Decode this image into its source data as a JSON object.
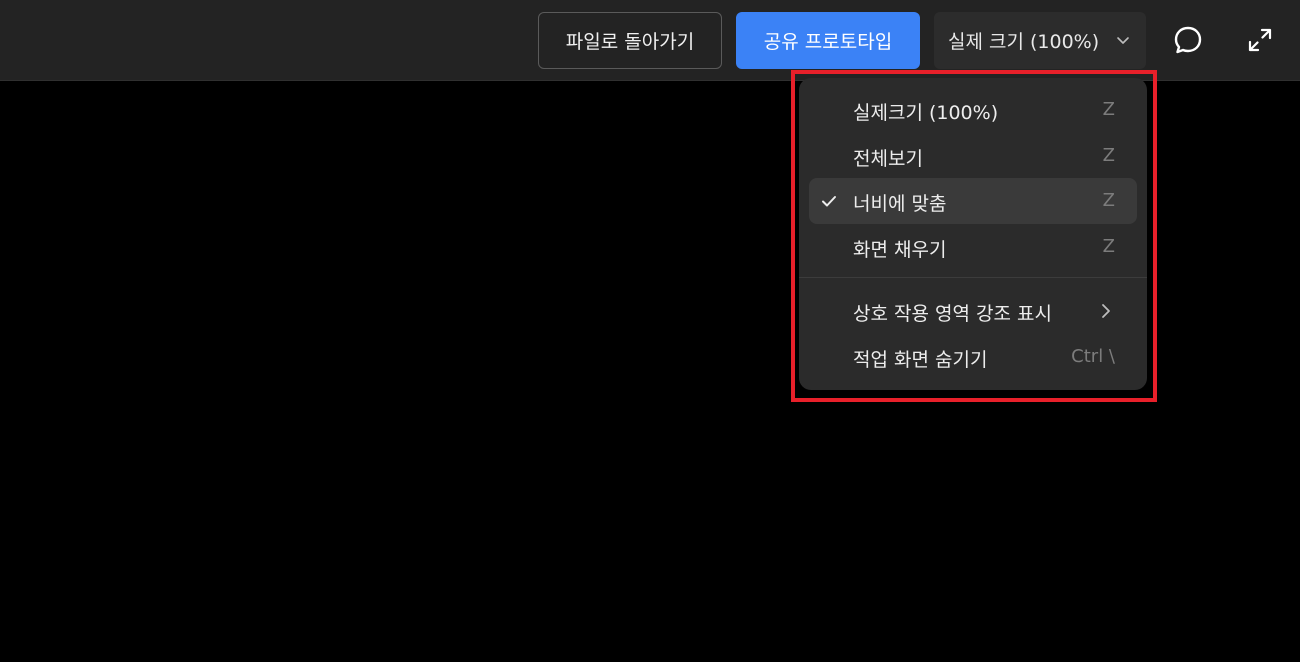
{
  "toolbar": {
    "back_label": "파일로 돌아가기",
    "share_label": "공유 프로토타입",
    "zoom_label": "실제 크기 (100%)",
    "comment_icon": "comment-bubble-icon",
    "expand_icon": "expand-fullscreen-icon"
  },
  "menu": {
    "items": [
      {
        "label": "실제크기 (100%)",
        "shortcut": "Z",
        "checked": false
      },
      {
        "label": "전체보기",
        "shortcut": "Z",
        "checked": false
      },
      {
        "label": "너비에 맞춤",
        "shortcut": "Z",
        "checked": true
      },
      {
        "label": "화면 채우기",
        "shortcut": "Z",
        "checked": false
      },
      {
        "label": "상호 작용 영역 강조 표시",
        "shortcut": "",
        "submenu": true
      },
      {
        "label": "적업 화면 숨기기",
        "shortcut": "Ctrl \\",
        "checked": false
      }
    ]
  },
  "colors": {
    "accent": "#3b82f6",
    "highlight": "#e8202a",
    "topbar_bg": "#232323",
    "menu_bg": "#2b2b2b",
    "canvas_bg": "#000000"
  }
}
